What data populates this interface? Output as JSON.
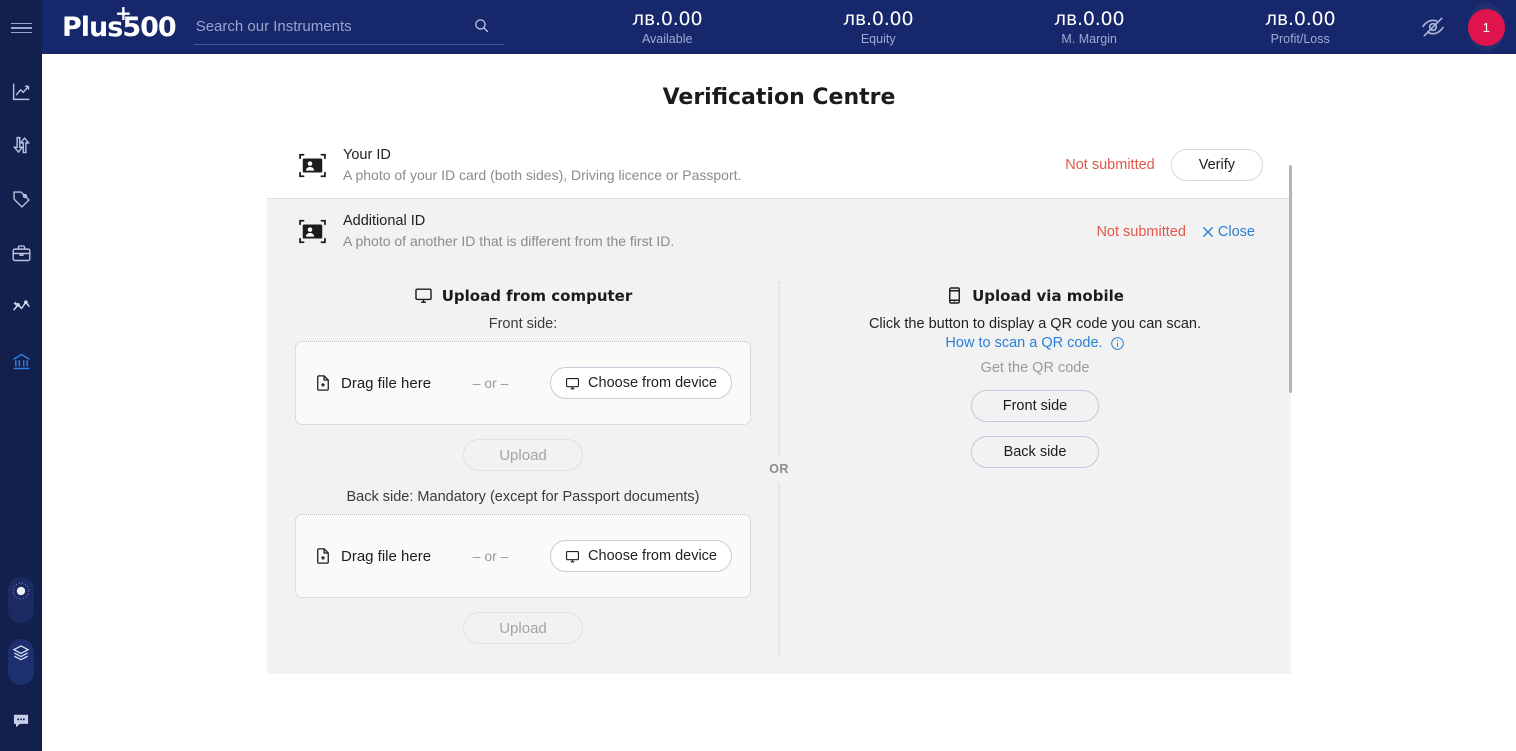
{
  "rail": {
    "menu_icon": "hamburger-menu-icon",
    "items": [
      {
        "name": "charts",
        "icon": "line-chart-icon"
      },
      {
        "name": "trade",
        "icon": "trade-arrows-icon"
      },
      {
        "name": "instruments",
        "icon": "price-tag-icon"
      },
      {
        "name": "portfolio",
        "icon": "briefcase-icon"
      },
      {
        "name": "analytics",
        "icon": "sparkline-icon"
      },
      {
        "name": "funds",
        "icon": "bank-icon",
        "active": true
      }
    ],
    "bottom": [
      {
        "name": "theme-toggle",
        "icon": "dial-knob-icon"
      },
      {
        "name": "layers",
        "icon": "layers-stack-icon",
        "active": true
      },
      {
        "name": "chat",
        "icon": "chat-bubble-icon"
      }
    ]
  },
  "header": {
    "logo": "Plus500",
    "logo_plus": "+",
    "search": {
      "placeholder": "Search our Instruments",
      "value": "",
      "icon": "search-icon"
    },
    "balances": [
      {
        "value": "лв.0.00",
        "label": "Available"
      },
      {
        "value": "лв.0.00",
        "label": "Equity"
      },
      {
        "value": "лв.0.00",
        "label": "M. Margin"
      },
      {
        "value": "лв.0.00",
        "label": "Profit/Loss"
      }
    ],
    "hide_balance_icon": "eye-off-icon",
    "avatar_badge": "1",
    "avatar_color": "#e0144c"
  },
  "page": {
    "title": "Verification Centre"
  },
  "documents": [
    {
      "icon": "id-card-icon",
      "title": "Your ID",
      "subtitle": "A photo of your ID card (both sides), Driving licence or Passport.",
      "status": "Not submitted",
      "action_label": "Verify"
    },
    {
      "icon": "id-card-icon",
      "title": "Additional ID",
      "subtitle": "A photo of another ID that is different from the first ID.",
      "status": "Not submitted",
      "action_label": "Close",
      "close_icon": "close-x-icon"
    }
  ],
  "upload": {
    "computer": {
      "icon": "monitor-icon",
      "heading": "Upload from computer",
      "front_label": "Front side:",
      "back_label": "Back side: Mandatory (except for Passport documents)",
      "drag_text": "Drag file here",
      "drag_icon": "file-add-icon",
      "or_text": "– or –",
      "choose_label": "Choose from device",
      "choose_icon": "monitor-icon",
      "upload_label": "Upload"
    },
    "divider_text": "OR",
    "mobile": {
      "icon": "mobile-phone-icon",
      "heading": "Upload via mobile",
      "line1": "Click the button to display a QR code you can scan.",
      "line2": "How to scan a QR code.",
      "line2_icon": "info-circle-icon",
      "line3": "Get the QR code",
      "front_button": "Front side",
      "back_button": "Back side"
    }
  },
  "colors": {
    "brand_navy": "#17276b",
    "rail_navy": "#131f4d",
    "status_red": "#e2574c",
    "link_blue": "#2a7fd4",
    "badge_pink": "#e0144c",
    "panel_grey": "#f2f2f2"
  }
}
